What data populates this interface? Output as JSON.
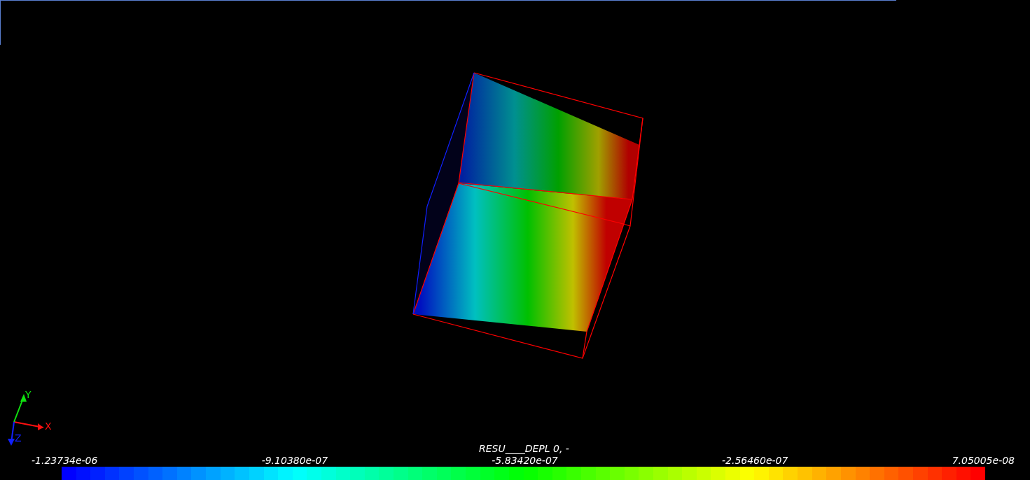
{
  "viewport": {
    "axes": [
      {
        "kind": "x",
        "label": "X"
      },
      {
        "kind": "y",
        "label": "Y"
      },
      {
        "kind": "z",
        "label": "Z"
      }
    ],
    "legend": {
      "title": "RESU____DEPL 0, -",
      "labels": [
        "-1.23734e-06",
        "-9.10380e-07",
        "-5.83420e-07",
        "-2.56460e-07",
        "7.05005e-08"
      ]
    }
  }
}
